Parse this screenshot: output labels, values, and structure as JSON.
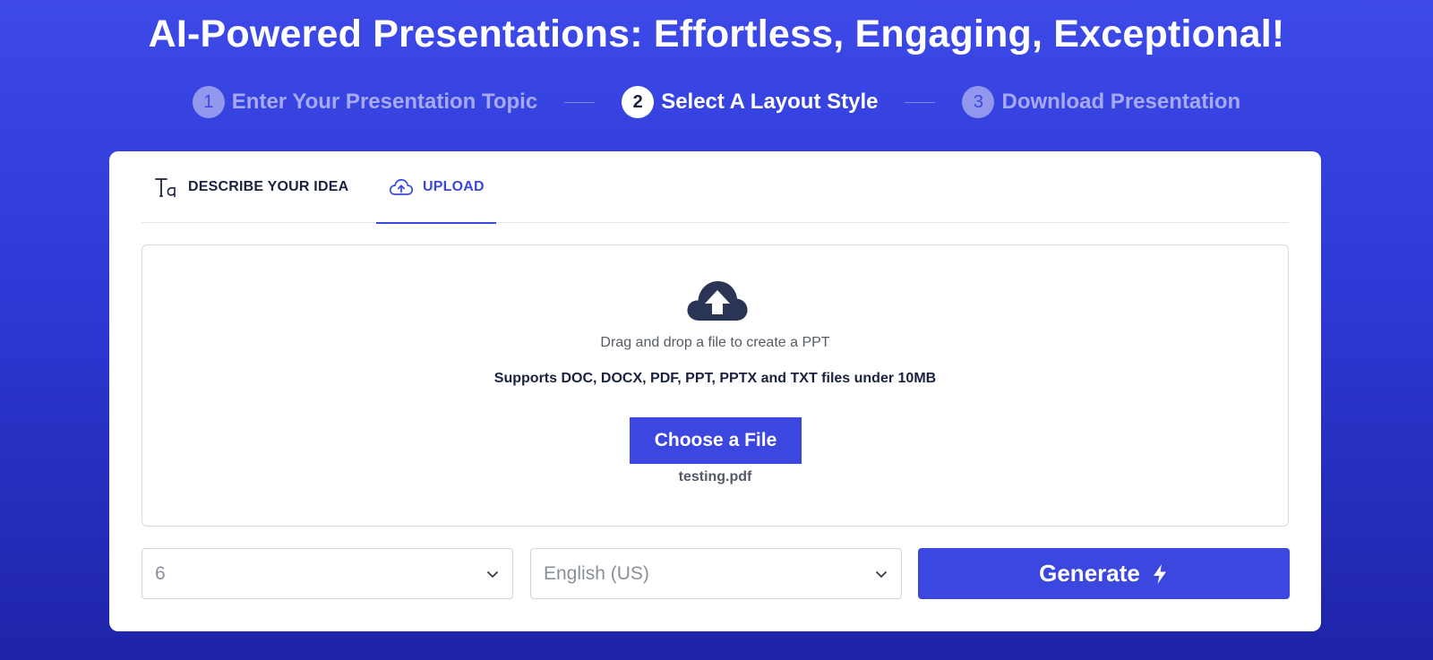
{
  "hero": {
    "title": "AI-Powered Presentations: Effortless, Engaging, Exceptional!"
  },
  "steps": [
    {
      "number": "1",
      "label": "Enter Your Presentation Topic"
    },
    {
      "number": "2",
      "label": "Select A Layout Style"
    },
    {
      "number": "3",
      "label": "Download Presentation"
    }
  ],
  "active_step": 2,
  "tabs": {
    "describe_label": "DESCRIBE YOUR IDEA",
    "describe_icon": "text-type-icon",
    "upload_label": "UPLOAD",
    "upload_icon": "cloud-upload-icon",
    "active": "upload"
  },
  "dropzone": {
    "icon": "cloud-upload-icon",
    "drag_text": "Drag and drop a file to create a PPT",
    "support_text": "Supports DOC, DOCX, PDF, PPT, PPTX and TXT files under 10MB",
    "choose_label": "Choose a File",
    "file_name": "testing.pdf"
  },
  "controls": {
    "slides_value": "6",
    "language_value": "English (US)",
    "generate_label": "Generate",
    "generate_icon": "lightning-bolt-icon"
  },
  "colors": {
    "accent": "#3b47df",
    "background_top": "#3d4ae8",
    "background_bottom": "#1e24a8",
    "dark_text": "#1b2240"
  }
}
